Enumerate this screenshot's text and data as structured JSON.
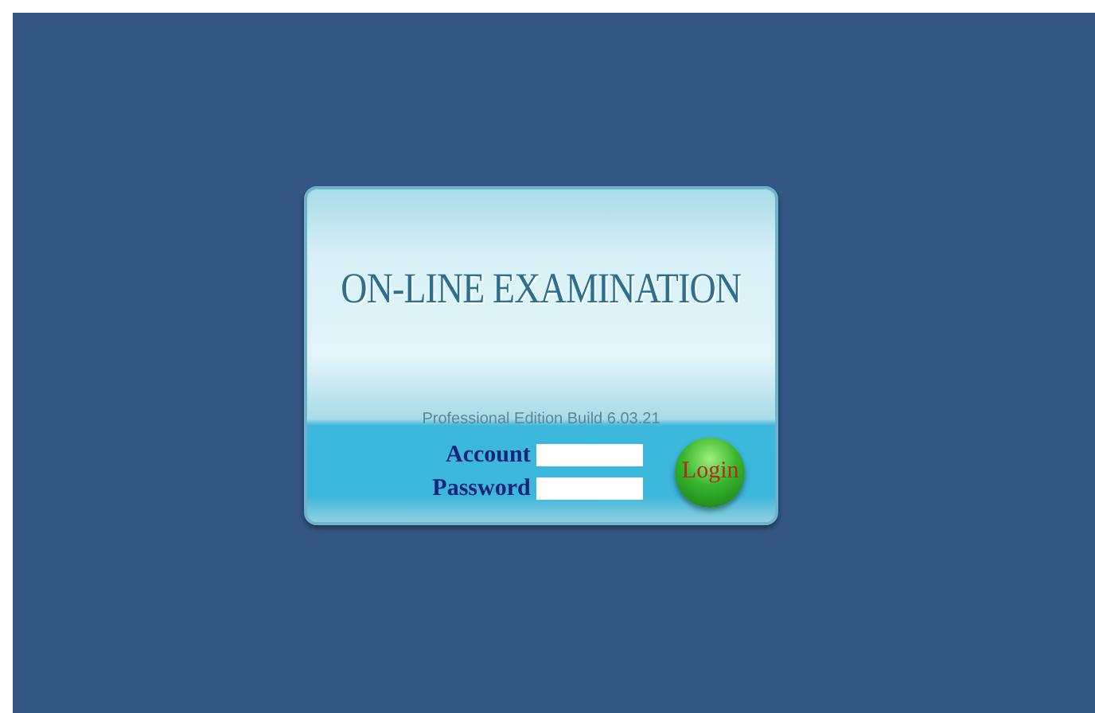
{
  "title": "ON-LINE EXAMINATION",
  "edition": "Professional Edition Build 6.03.21",
  "fields": [
    {
      "label": "Account"
    },
    {
      "label": "Password"
    }
  ],
  "login_button": "Login"
}
